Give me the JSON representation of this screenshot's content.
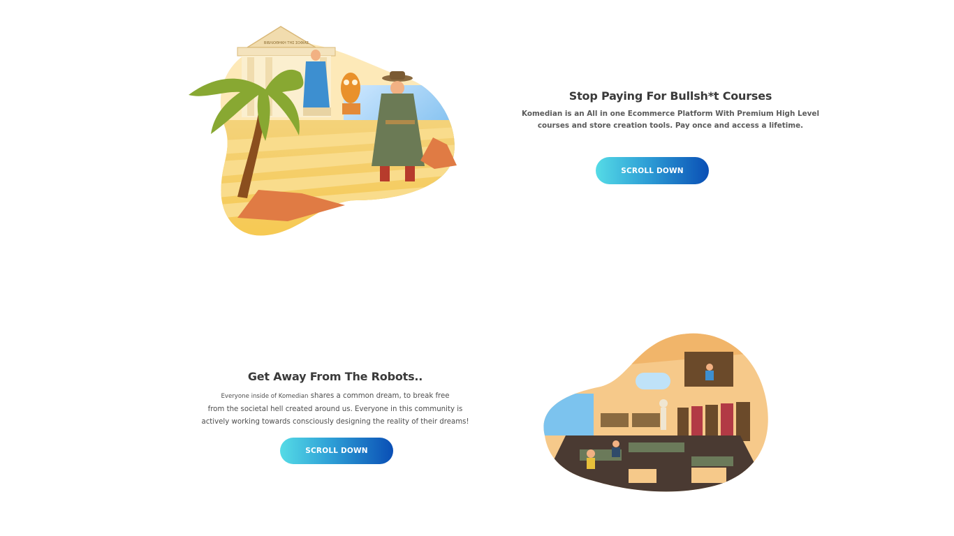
{
  "section1": {
    "heading": "Stop Paying For Bullsh*t Courses",
    "body_line1": "Komedian is an All in one Ecommerce Platform With Premium High Level",
    "body_line2": "courses and store creation tools. Pay once and access a lifetime.",
    "cta_label": "SCROLL DOWN",
    "temple_sign": "ΒΙΒΛΙΟΘΗΚΗ ΤΗΣ ΣΟΦΙΑΣ"
  },
  "section2": {
    "heading": "Get Away From The Robots..",
    "body_lead": "Everyone inside of ",
    "body_brand": "Komedian",
    "body_line1_rest": "  shares a common dream, to break free",
    "body_line2": "from the societal hell created around us. Everyone in this community is",
    "body_line3": "actively working towards consciously designing the reality of their dreams!",
    "cta_label": "SCROLL DOWN"
  },
  "colors": {
    "cta_gradient_start": "#55dbe6",
    "cta_gradient_end": "#0a4fb5",
    "heading": "#3a3a3a"
  }
}
